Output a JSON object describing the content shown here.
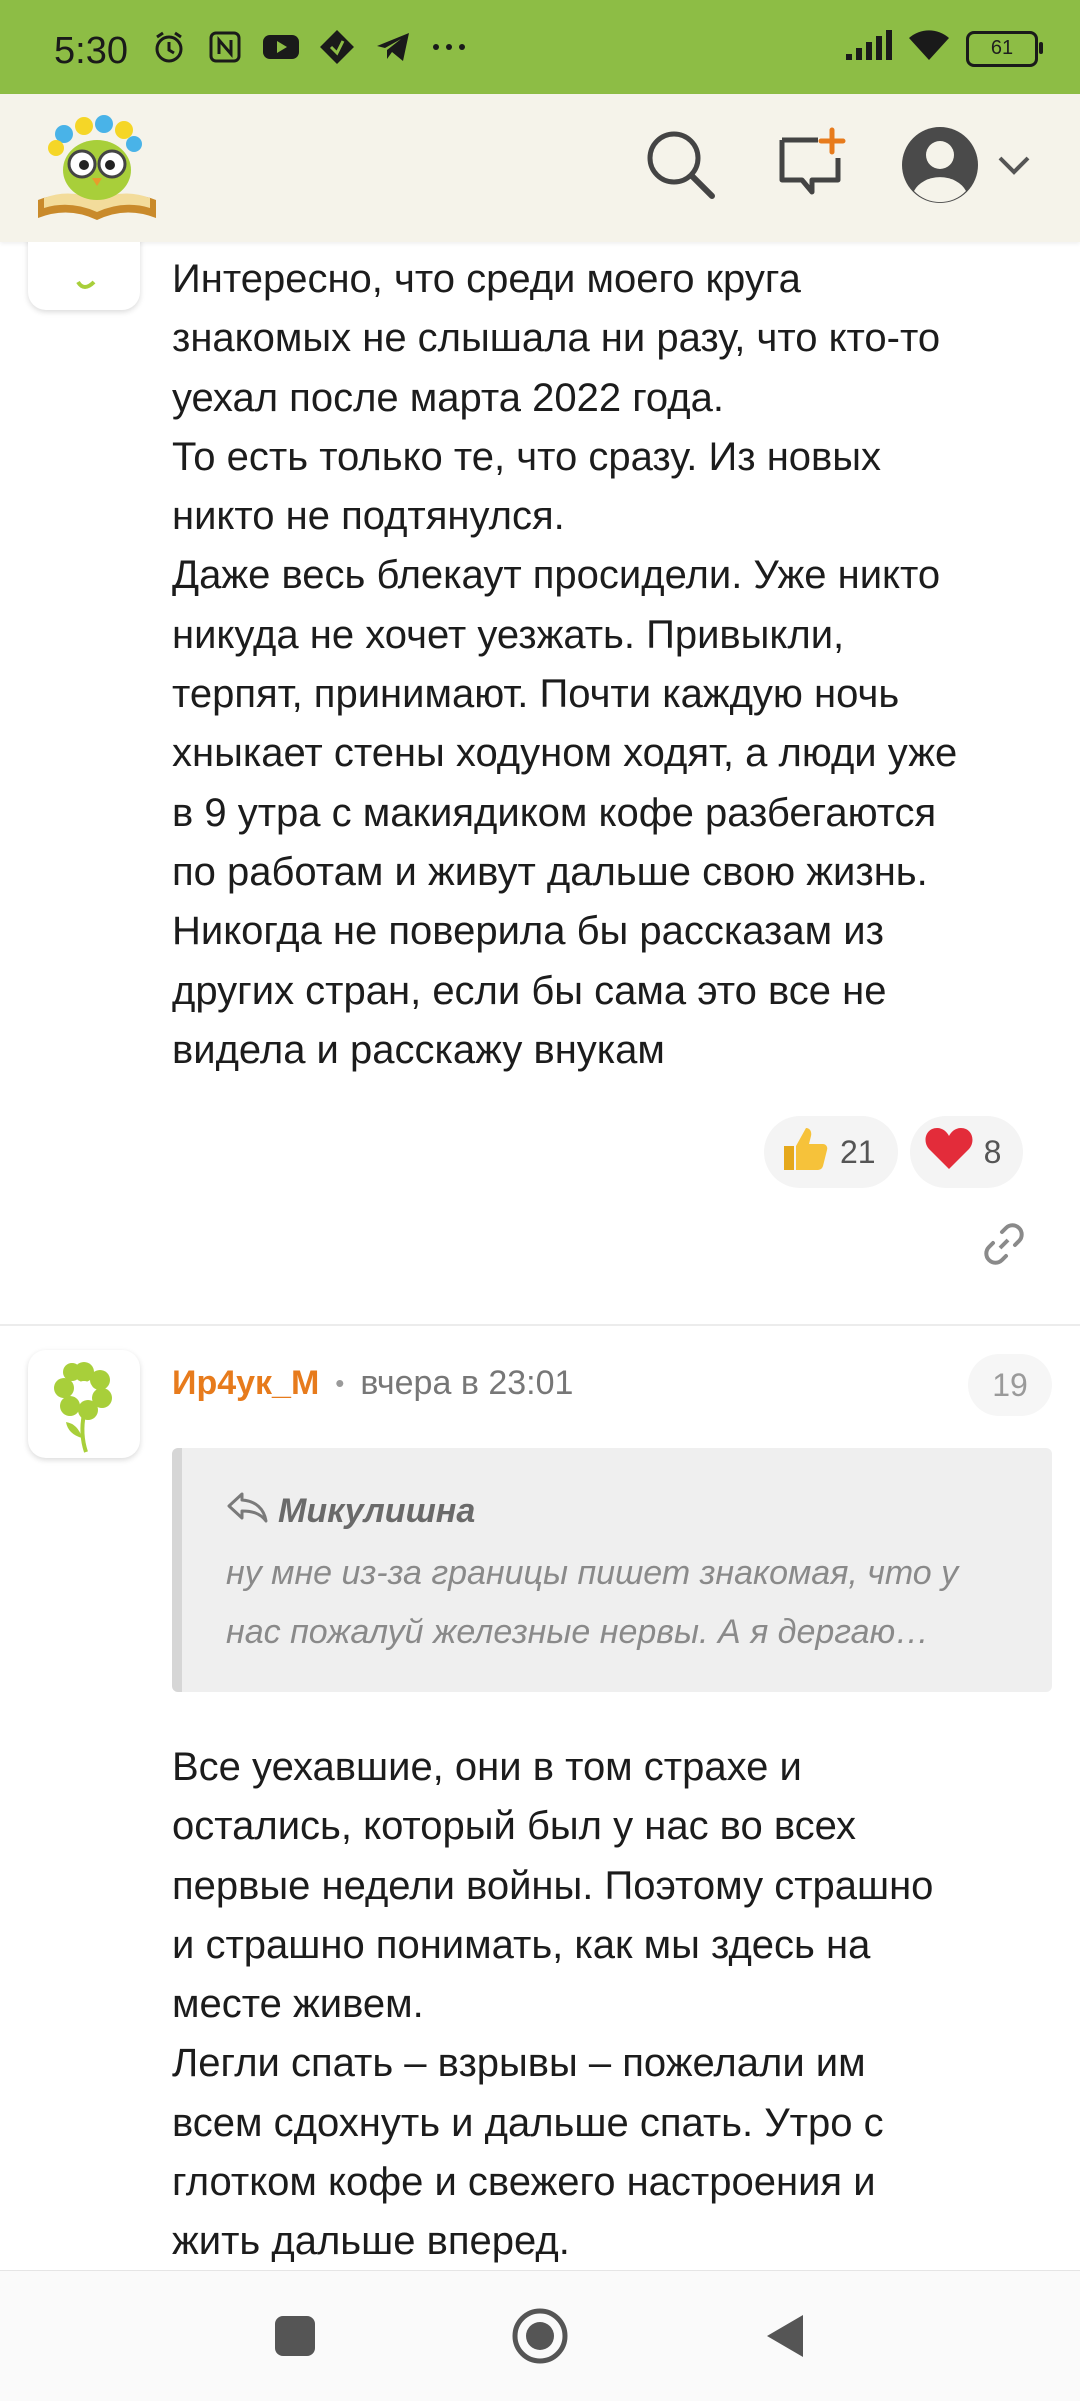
{
  "status_bar": {
    "time": "5:30",
    "battery": "61",
    "icons": [
      "alarm-icon",
      "nfc-icon",
      "youtube-icon",
      "app-icon",
      "telegram-icon",
      "more-icon"
    ],
    "right_icons": [
      "signal-icon",
      "wifi-icon",
      "battery-icon"
    ],
    "background": "#8dbd45"
  },
  "app_bar": {
    "background": "#f5f3ea",
    "logo_icon": "owl-book-logo",
    "search_icon": "search-icon",
    "new_post_icon": "new-message-icon",
    "profile_icon": "avatar-icon"
  },
  "comment1": {
    "text": "Интересно, что среди моего круга\nзнакомых не слышала ни разу, что кто-то\nуехал после марта 2022 года.\nТо есть только те, что сразу. Из новых\nникто не подтянулся.\nДаже весь блекаут просидели. Уже никто\nникуда не хочет уезжать. Привыкли,\nтерпят, принимают. Почти каждую ночь\nхныкает стены ходуном ходят, а люди уже\nв 9 утра с макиядиком кофе разбегаются\nпо работам и живут дальше свою жизнь.\nНикогда не поверила бы рассказам из\nдругих стран, если бы сама это все не\nвидела и расскажу внукам",
    "likes": "21",
    "hearts": "8"
  },
  "comment2": {
    "author": "Ир4ук_М",
    "separator": "•",
    "time": "вчера в 23:01",
    "count": "19",
    "quote_author": "Микулишна",
    "quote_text": "ну мне из-за границы пишет знакомая, что у нас пожалуй железные нервы. А я дергаю…",
    "text": "Все уехавшие, они в том страхе и\nостались, который был у нас во всех\nпервые недели войны. Поэтому страшно\nи страшно понимать, как мы здесь на\nместе живем.\nЛегли спать – взрывы – пожелали им\nвсем сдохнуть и дальше спать. Утро с\nглотком кофе и свежего настроения и\nжить дальше вперед."
  },
  "colors": {
    "author": "#e77b1c",
    "accent_green": "#8dbd45"
  }
}
